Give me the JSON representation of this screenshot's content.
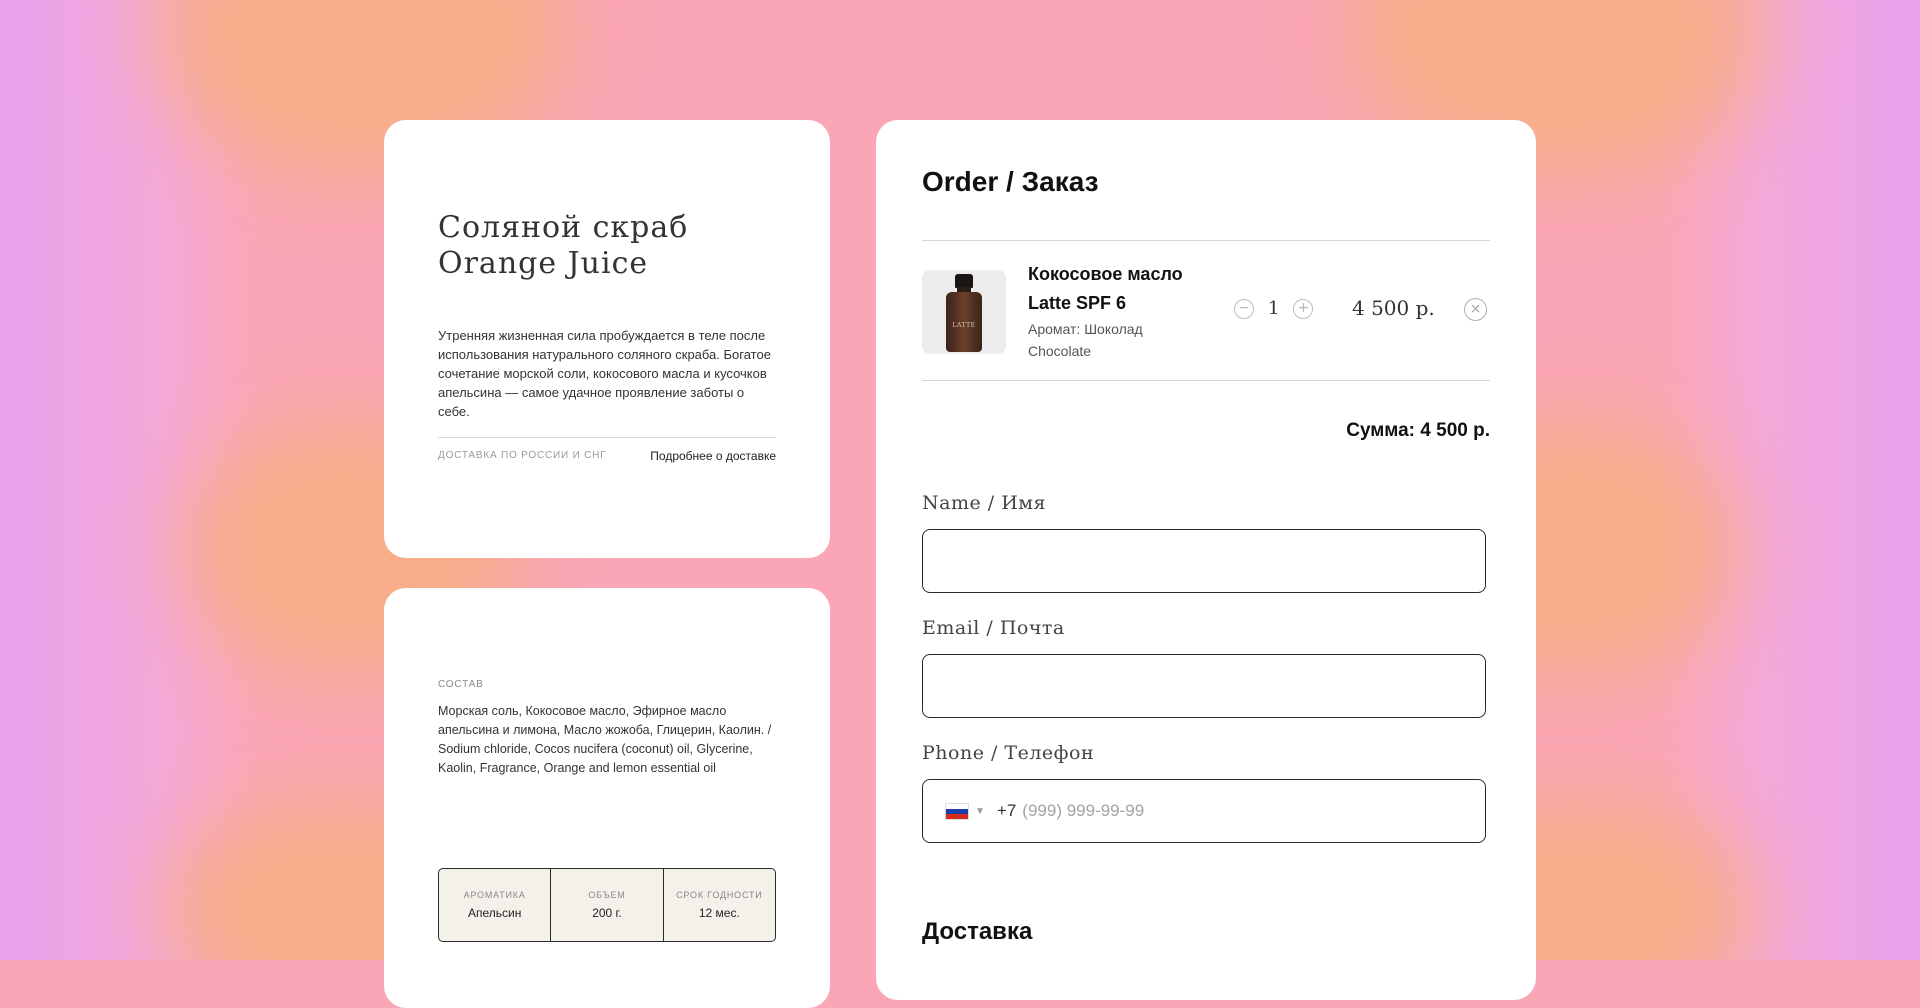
{
  "product": {
    "title": "Соляной скраб Orange Juice",
    "description": "Утренняя жизненная сила пробуждается в теле после использования натурального соляного скраба. Богатое сочетание морской соли, кокосового масла и кусочков апельсина — самое удачное проявление заботы о себе.",
    "shipping_label": "Доставка по России и СНГ",
    "shipping_link": "Подробнее о доставке"
  },
  "composition": {
    "label": "Состав",
    "text": "Морская соль, Кокосовое масло, Эфирное масло апельсина и лимона, Масло жожоба, Глицерин, Каолин. / Sodium chloride, Cocos nucifera (coconut) oil, Glycerine, Kaolin, Fragrance, Orange and lemon essential oil",
    "attributes": [
      {
        "key": "Ароматика",
        "value": "Апельсин"
      },
      {
        "key": "Объем",
        "value": "200 г."
      },
      {
        "key": "Срок годности",
        "value": "12 мес."
      }
    ]
  },
  "order": {
    "title": "Order / Заказ",
    "item": {
      "name": "Кокосовое масло Latte SPF 6",
      "aroma": "Аромат: Шоколад Chocolate",
      "bottle_label": "LATTE",
      "quantity": "1",
      "price": "4 500 р.",
      "minus": "−",
      "plus": "+",
      "remove": "×"
    },
    "sum": "Сумма: 4 500 р.",
    "fields": {
      "name_label": "Name / Имя",
      "email_label": "Email / Почта",
      "phone_label": "Phone / Телефон",
      "phone_code": "+7",
      "phone_placeholder": "(999) 999-99-99",
      "country_flag": "russia-flag-icon"
    },
    "delivery_title": "Доставка"
  },
  "colors": {
    "background": "#fba6b6",
    "accent_orange": "#f7b07a",
    "accent_violet": "#e9a2ee",
    "card": "#ffffff",
    "attr_table_bg": "#f4f1ea"
  }
}
